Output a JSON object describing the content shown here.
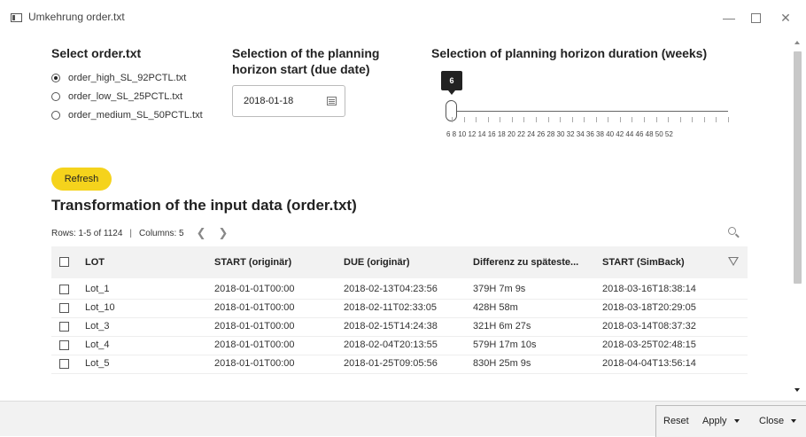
{
  "window": {
    "title": "Umkehrung order.txt"
  },
  "select_order": {
    "heading": "Select order.txt",
    "options": [
      {
        "label": "order_high_SL_92PCTL.txt",
        "checked": true
      },
      {
        "label": "order_low_SL_25PCTL.txt",
        "checked": false
      },
      {
        "label": "order_medium_SL_50PCTL.txt",
        "checked": false
      }
    ]
  },
  "planning_start": {
    "heading_line1": "Selection of the planning",
    "heading_line2": "horizon start (due date)",
    "value": "2018-01-18",
    "icon": "calendar-icon"
  },
  "duration": {
    "heading": "Selection of planning horizon duration (weeks)",
    "value": "6",
    "min": 6,
    "max": 52,
    "tick_labels": "6  8  10 12 14 16 18 20 22 24 26 28 30 32 34 36 38 40 42 44 46 48 50 52"
  },
  "refresh_label": "Refresh",
  "table": {
    "title": "Transformation of the input data (order.txt)",
    "rows_info": "Rows: 1-5 of 1124",
    "columns_info": "Columns: 5",
    "headers": [
      "LOT",
      "START (originär)",
      "DUE (originär)",
      "Differenz zu späteste...",
      "START (SimBack)"
    ],
    "rows": [
      [
        "Lot_1",
        "2018-01-01T00:00",
        "2018-02-13T04:23:56",
        "379H 7m 9s",
        "2018-03-16T18:38:14"
      ],
      [
        "Lot_10",
        "2018-01-01T00:00",
        "2018-02-11T02:33:05",
        "428H 58m",
        "2018-03-18T20:29:05"
      ],
      [
        "Lot_3",
        "2018-01-01T00:00",
        "2018-02-15T14:24:38",
        "321H 6m 27s",
        "2018-03-14T08:37:32"
      ],
      [
        "Lot_4",
        "2018-01-01T00:00",
        "2018-02-04T20:13:55",
        "579H 17m 10s",
        "2018-03-25T02:48:15"
      ],
      [
        "Lot_5",
        "2018-01-01T00:00",
        "2018-01-25T09:05:56",
        "830H 25m 9s",
        "2018-04-04T13:56:14"
      ]
    ]
  },
  "footer": {
    "reset": "Reset",
    "apply": "Apply",
    "close": "Close"
  }
}
